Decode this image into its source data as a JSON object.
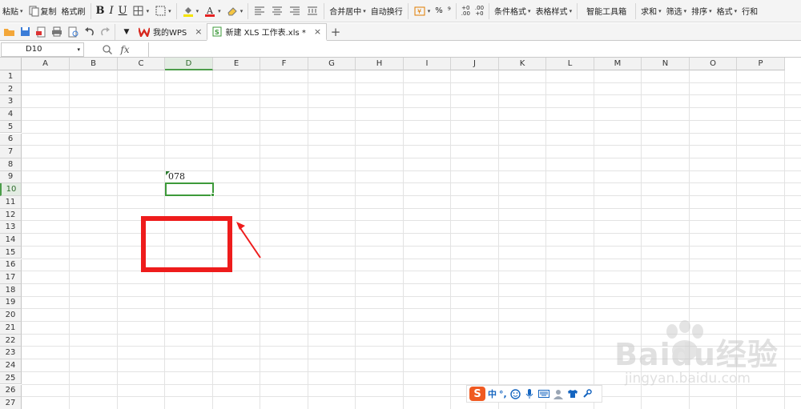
{
  "ribbon": {
    "paste": "粘贴",
    "copy": "复制",
    "format_painter": "格式刷",
    "bold": "B",
    "italic": "I",
    "underline": "U",
    "merge_center": "合并居中",
    "wrap_text": "自动换行",
    "percent": "%",
    "comma": "⁹",
    "inc_decimal": "+0\n.00",
    "dec_decimal": ".00\n+0",
    "conditional_format": "条件格式",
    "table_style": "表格样式",
    "smart_toolbox": "智能工具箱",
    "sum": "求和",
    "filter": "筛选",
    "sort": "排序",
    "format": "格式",
    "row_col": "行和"
  },
  "tabs": [
    {
      "label": "我的WPS",
      "active": false
    },
    {
      "label": "新建 XLS 工作表.xls *",
      "active": true
    }
  ],
  "formula_bar": {
    "name_box": "D10",
    "fx_label": "fx",
    "formula": ""
  },
  "columns": [
    "A",
    "B",
    "C",
    "D",
    "E",
    "F",
    "G",
    "H",
    "I",
    "J",
    "K",
    "L",
    "M",
    "N",
    "O",
    "P"
  ],
  "rows": [
    "1",
    "2",
    "3",
    "4",
    "5",
    "6",
    "7",
    "8",
    "9",
    "10",
    "11",
    "12",
    "13",
    "14",
    "15",
    "16",
    "17",
    "18",
    "19",
    "20",
    "21",
    "22",
    "23",
    "24",
    "25",
    "26",
    "27"
  ],
  "selected_cell": {
    "column": "D",
    "row": "10"
  },
  "cells": {
    "D9": "078"
  },
  "ime": {
    "chinese": "中",
    "punct": "°,"
  },
  "watermark": {
    "brand": "Baidu经验",
    "url": "jingyan.baidu.com"
  },
  "colors": {
    "accent_green": "#3d9a3a",
    "annotation_red": "#ee1c1c",
    "wps_red": "#d7281e",
    "ime_orange": "#f05a22"
  }
}
